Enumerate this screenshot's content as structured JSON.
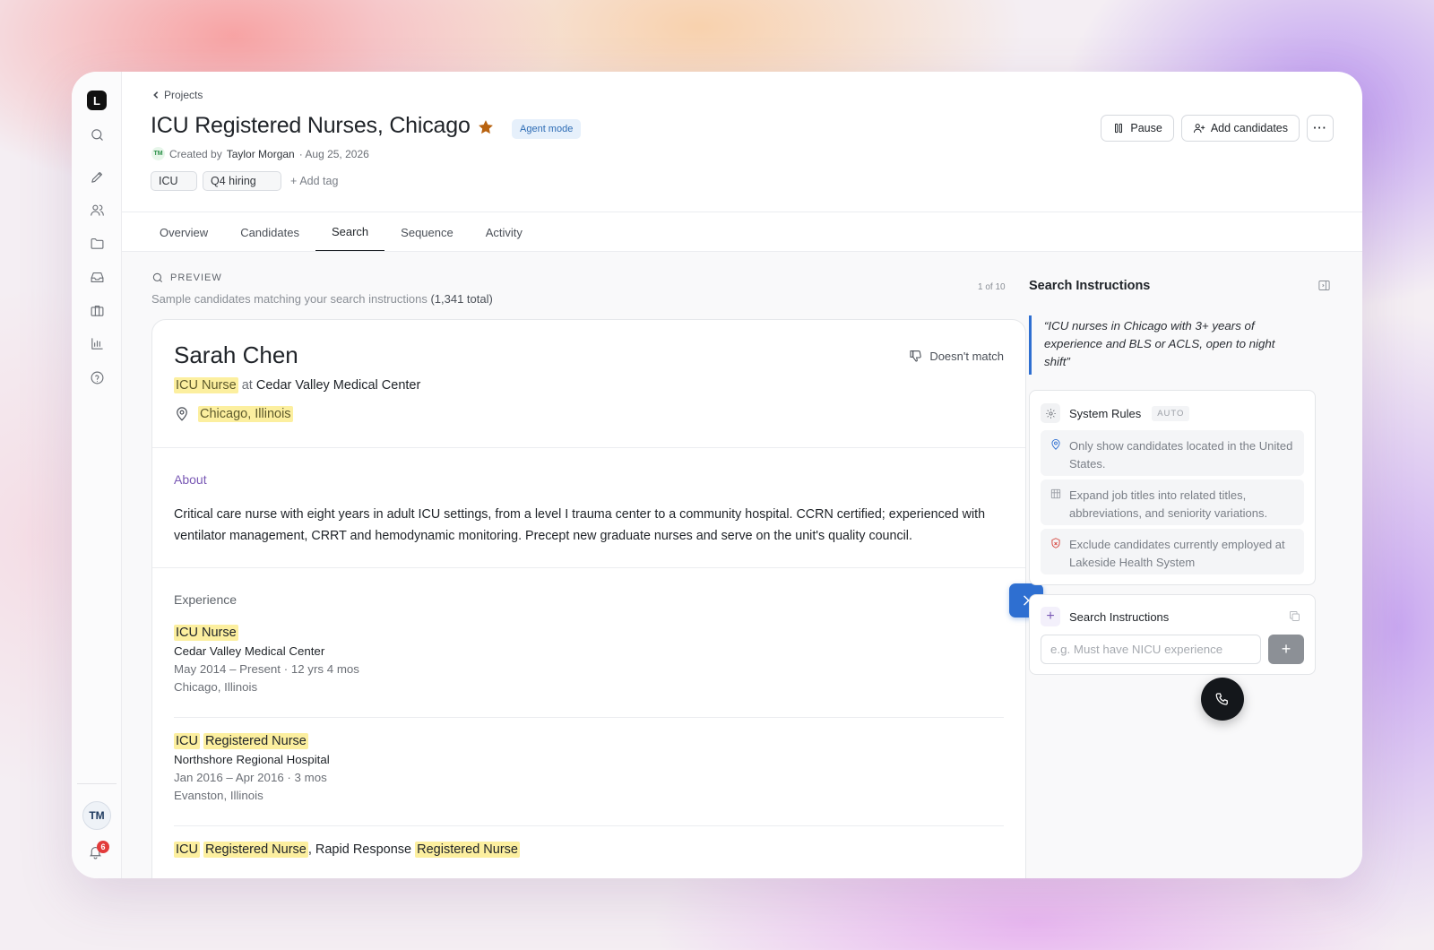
{
  "rail": {
    "logo": "L",
    "icons": [
      "search-icon",
      "edit-icon",
      "users-icon",
      "folder-icon",
      "inbox-icon",
      "briefcase-icon",
      "chart-icon",
      "help-icon"
    ],
    "user_initials": "TM",
    "notification_count": "6"
  },
  "header": {
    "breadcrumb": "Projects",
    "title": "ICU Registered Nurses, Chicago",
    "badge": "Agent mode",
    "creator_initials": "TM",
    "created_by_prefix": "Created by",
    "creator_name": "Taylor Morgan",
    "created_date": "· Aug 25, 2026",
    "tags": [
      "ICU",
      "Q4 hiring"
    ],
    "add_tag": "Add tag",
    "pause_label": "Pause",
    "add_candidates_label": "Add candidates",
    "more_label": "···"
  },
  "tabs": [
    "Overview",
    "Candidates",
    "Search",
    "Sequence",
    "Activity"
  ],
  "active_tab": "Search",
  "preview": {
    "label": "PREVIEW",
    "subtitle": "Sample candidates matching your search instructions",
    "total": "(1,341 total)",
    "pager": "1 of 10"
  },
  "candidate": {
    "name": "Sarah Chen",
    "no_match_label": "Doesn't match",
    "title": "ICU Nurse",
    "at": "at",
    "company": "Cedar Valley Medical Center",
    "location": "Chicago, Illinois",
    "about_heading": "About",
    "about_text": "Critical care nurse with eight years in adult ICU settings, from a level I trauma center to a community hospital. CCRN certified; experienced with ventilator management, CRRT and hemodynamic monitoring. Precept new graduate nurses and serve on the unit's quality council.",
    "experience_heading": "Experience",
    "experience": [
      {
        "title_parts": [
          "ICU Nurse"
        ],
        "company": "Cedar Valley Medical Center",
        "dates": "May 2014 – Present · 12 yrs 4 mos",
        "location": "Chicago, Illinois"
      },
      {
        "title_parts": [
          "ICU",
          "Registered Nurse"
        ],
        "company": "Northshore Regional Hospital",
        "dates": "Jan 2016 – Apr 2016 · 3 mos",
        "location": "Evanston, Illinois"
      },
      {
        "title_parts": [
          "ICU",
          "Registered Nurse",
          ", Rapid Response",
          "Registered Nurse"
        ]
      }
    ]
  },
  "instructions_panel": {
    "title": "Search Instructions",
    "quote": "“ICU nurses in Chicago with 3+ years of experience and BLS or ACLS, open to night shift”",
    "system_rules_label": "System Rules",
    "auto_label": "AUTO",
    "rules": [
      {
        "icon": "location-pin-icon",
        "text": "Only show candidates located in the United States.",
        "color": "#2e6fd1"
      },
      {
        "icon": "building-icon",
        "text": "Expand job titles into related titles, abbreviations, and seniority variations.",
        "color": "#9a9ea5"
      },
      {
        "icon": "shield-icon",
        "text": "Exclude candidates currently employed at Lakeside Health System",
        "color": "#d6453d"
      }
    ],
    "search_instructions_label": "Search Instructions",
    "input_placeholder": "e.g. Must have NICU experience",
    "add_label": "+"
  },
  "colors": {
    "accent": "#2e6fd1",
    "highlight": "#fcef9f",
    "agent_badge_bg": "#e6f0fb",
    "star": "#b8620f"
  }
}
